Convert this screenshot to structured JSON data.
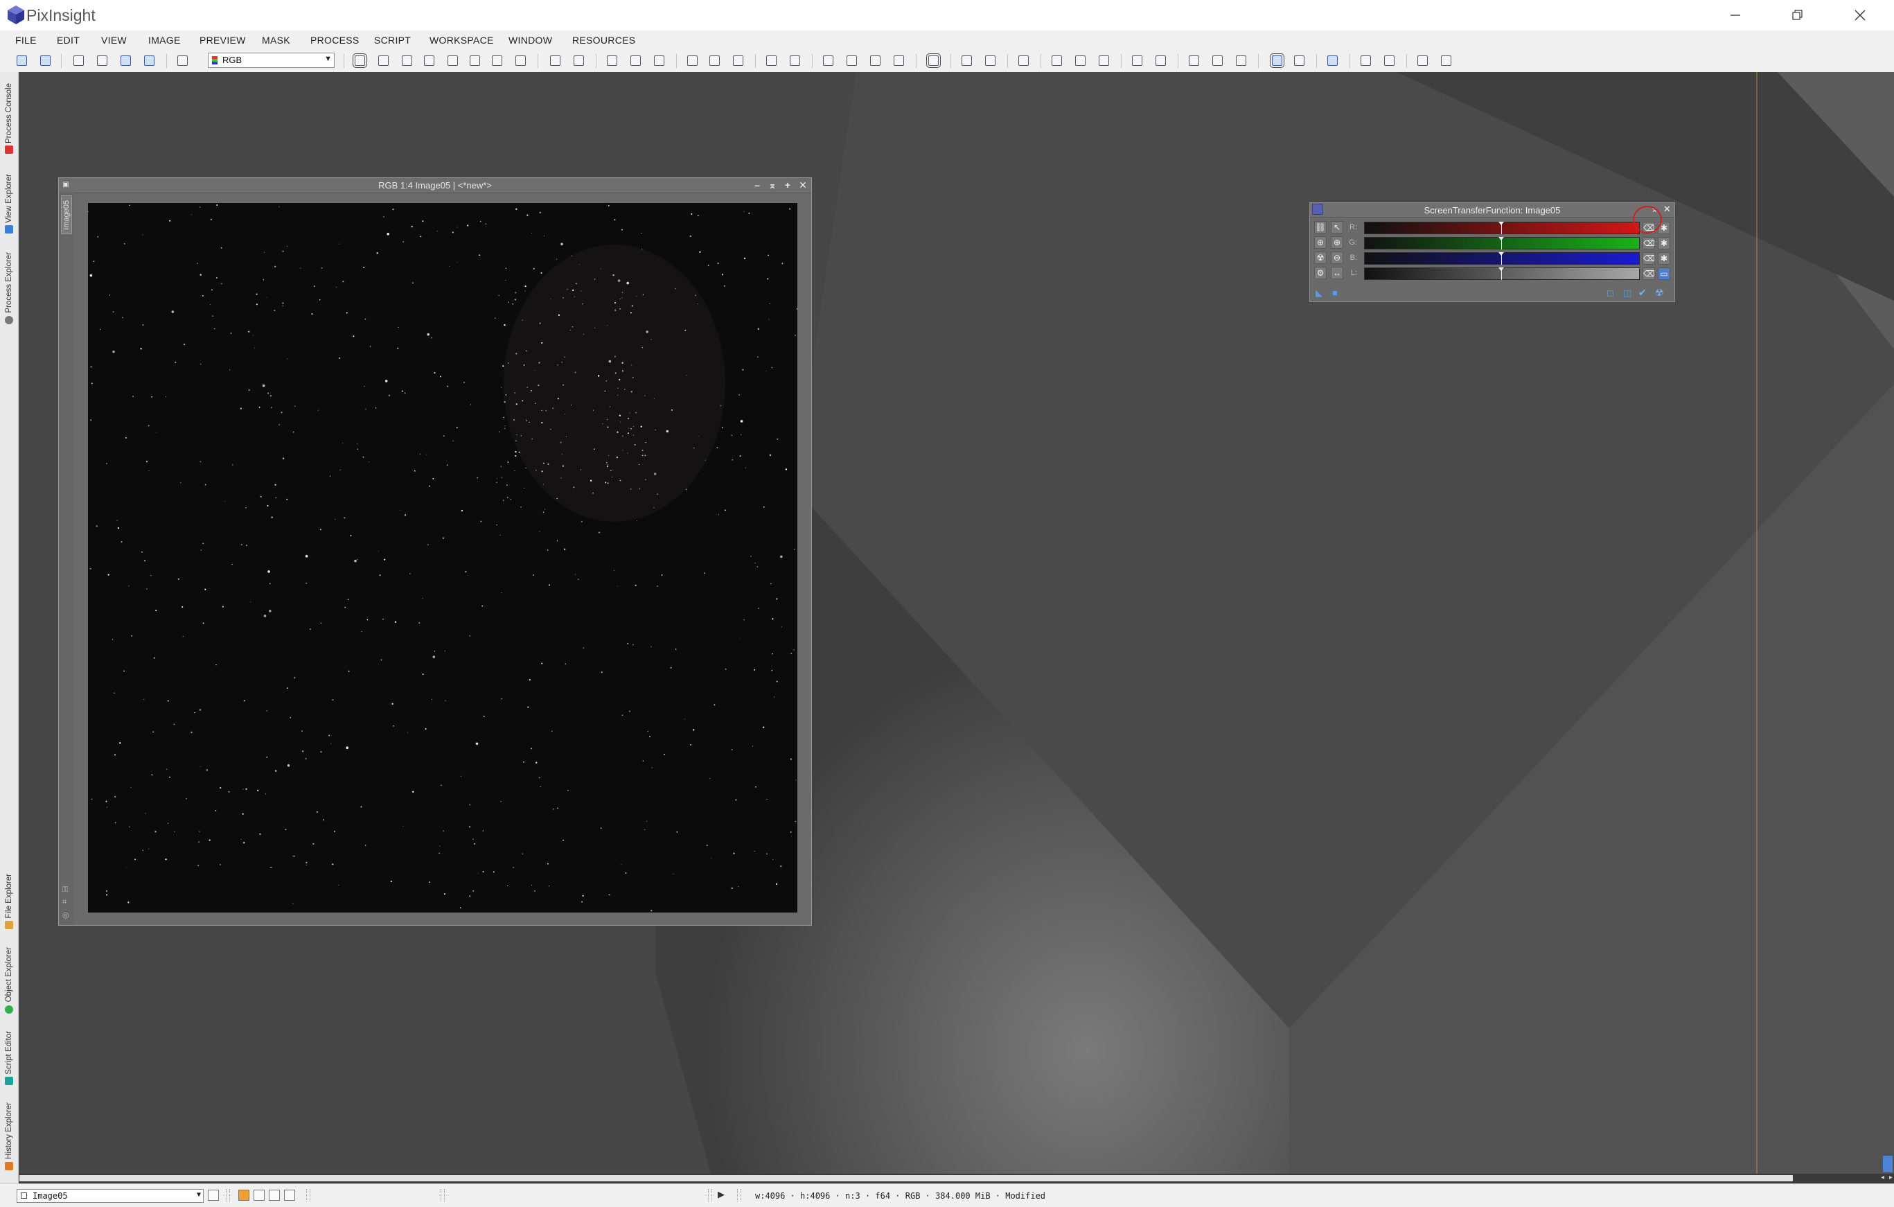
{
  "app": {
    "title": "PixInsight"
  },
  "window_controls": {
    "minimize": "—",
    "restore": "❐",
    "close": "✕"
  },
  "menu": [
    "FILE",
    "EDIT",
    "VIEW",
    "IMAGE",
    "PREVIEW",
    "MASK",
    "PROCESS",
    "SCRIPT",
    "WORKSPACE",
    "WINDOW",
    "RESOURCES"
  ],
  "toolbar": {
    "channel_select": "RGB"
  },
  "left_dock": {
    "top_tabs": [
      "Process Console",
      "View Explorer",
      "Process Explorer"
    ],
    "bottom_tabs": [
      "File Explorer",
      "Object Explorer",
      "Script Editor",
      "History Explorer"
    ]
  },
  "image_window": {
    "title": "RGB 1:4 Image05 | <*new*>",
    "side_tab": "Image05"
  },
  "stf": {
    "title": "ScreenTransferFunction: Image05",
    "channels": [
      {
        "label": "R:",
        "color": "#d41515"
      },
      {
        "label": "G:",
        "color": "#18b418"
      },
      {
        "label": "B:",
        "color": "#1a1ad2"
      },
      {
        "label": "L:",
        "color": "#a8a8a8"
      }
    ],
    "highlighted_button": "auto-stretch-button"
  },
  "status": {
    "view": "Image05",
    "info": "w:4096 · h:4096 · n:3 · f64 · RGB · 384.000 MiB · Modified"
  }
}
